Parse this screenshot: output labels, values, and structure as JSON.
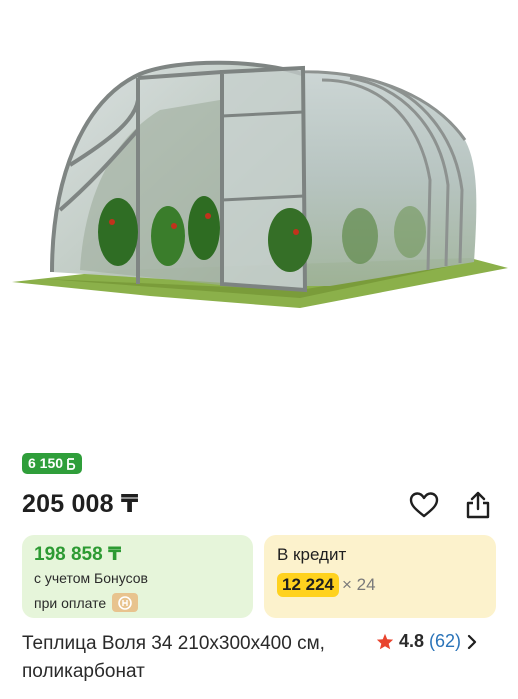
{
  "product": {
    "image_alt": "greenhouse-photo",
    "title": "Теплица Воля 34 210х300х400 см, поликарбонат"
  },
  "bonus_badge": {
    "value": "6 150",
    "icon": "bonus-coin-icon",
    "color": "#2f9e3a"
  },
  "price": {
    "main": "205 008 ₸"
  },
  "actions": {
    "favorite_icon": "heart-icon",
    "share_icon": "share-icon"
  },
  "bonus_card": {
    "price": "198 858 ₸",
    "note1": "с учетом Бонусов",
    "note2": "при оплате",
    "badge_icon": "payment-logo-icon",
    "bg_color": "#e6f5da"
  },
  "credit_card": {
    "label": "В кредит",
    "amount": "12 224",
    "term": "× 24",
    "bg_color": "#fcf2cc"
  },
  "rating": {
    "value": "4.8",
    "count": "(62)",
    "star_icon": "star-icon",
    "arrow_icon": "chevron-right-icon"
  }
}
